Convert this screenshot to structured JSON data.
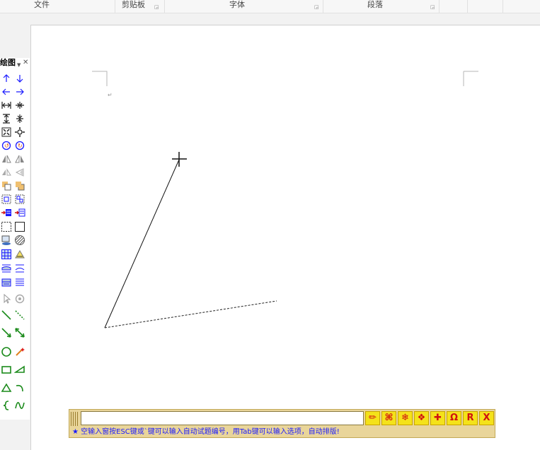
{
  "ribbon": {
    "groups": [
      {
        "label": "文件"
      },
      {
        "label": "剪贴板"
      },
      {
        "label": "字体"
      },
      {
        "label": "段落"
      }
    ]
  },
  "toolbar": {
    "title": "绘图"
  },
  "ime": {
    "buttons": [
      "✏",
      "⌘",
      "❄",
      "❖",
      "✚",
      "Ω",
      "R",
      "X"
    ],
    "hint": "★ 空输入窗按ESC键或`键可以输入自动试题编号，用Tab键可以输入选项，自动排版!"
  },
  "colors": {
    "accent_blue": "#1a1aff",
    "draw_green": "#1a8a1a",
    "ime_bg": "#e9d59a",
    "ime_button": "#f4e21a",
    "ime_icon": "#d01010"
  }
}
